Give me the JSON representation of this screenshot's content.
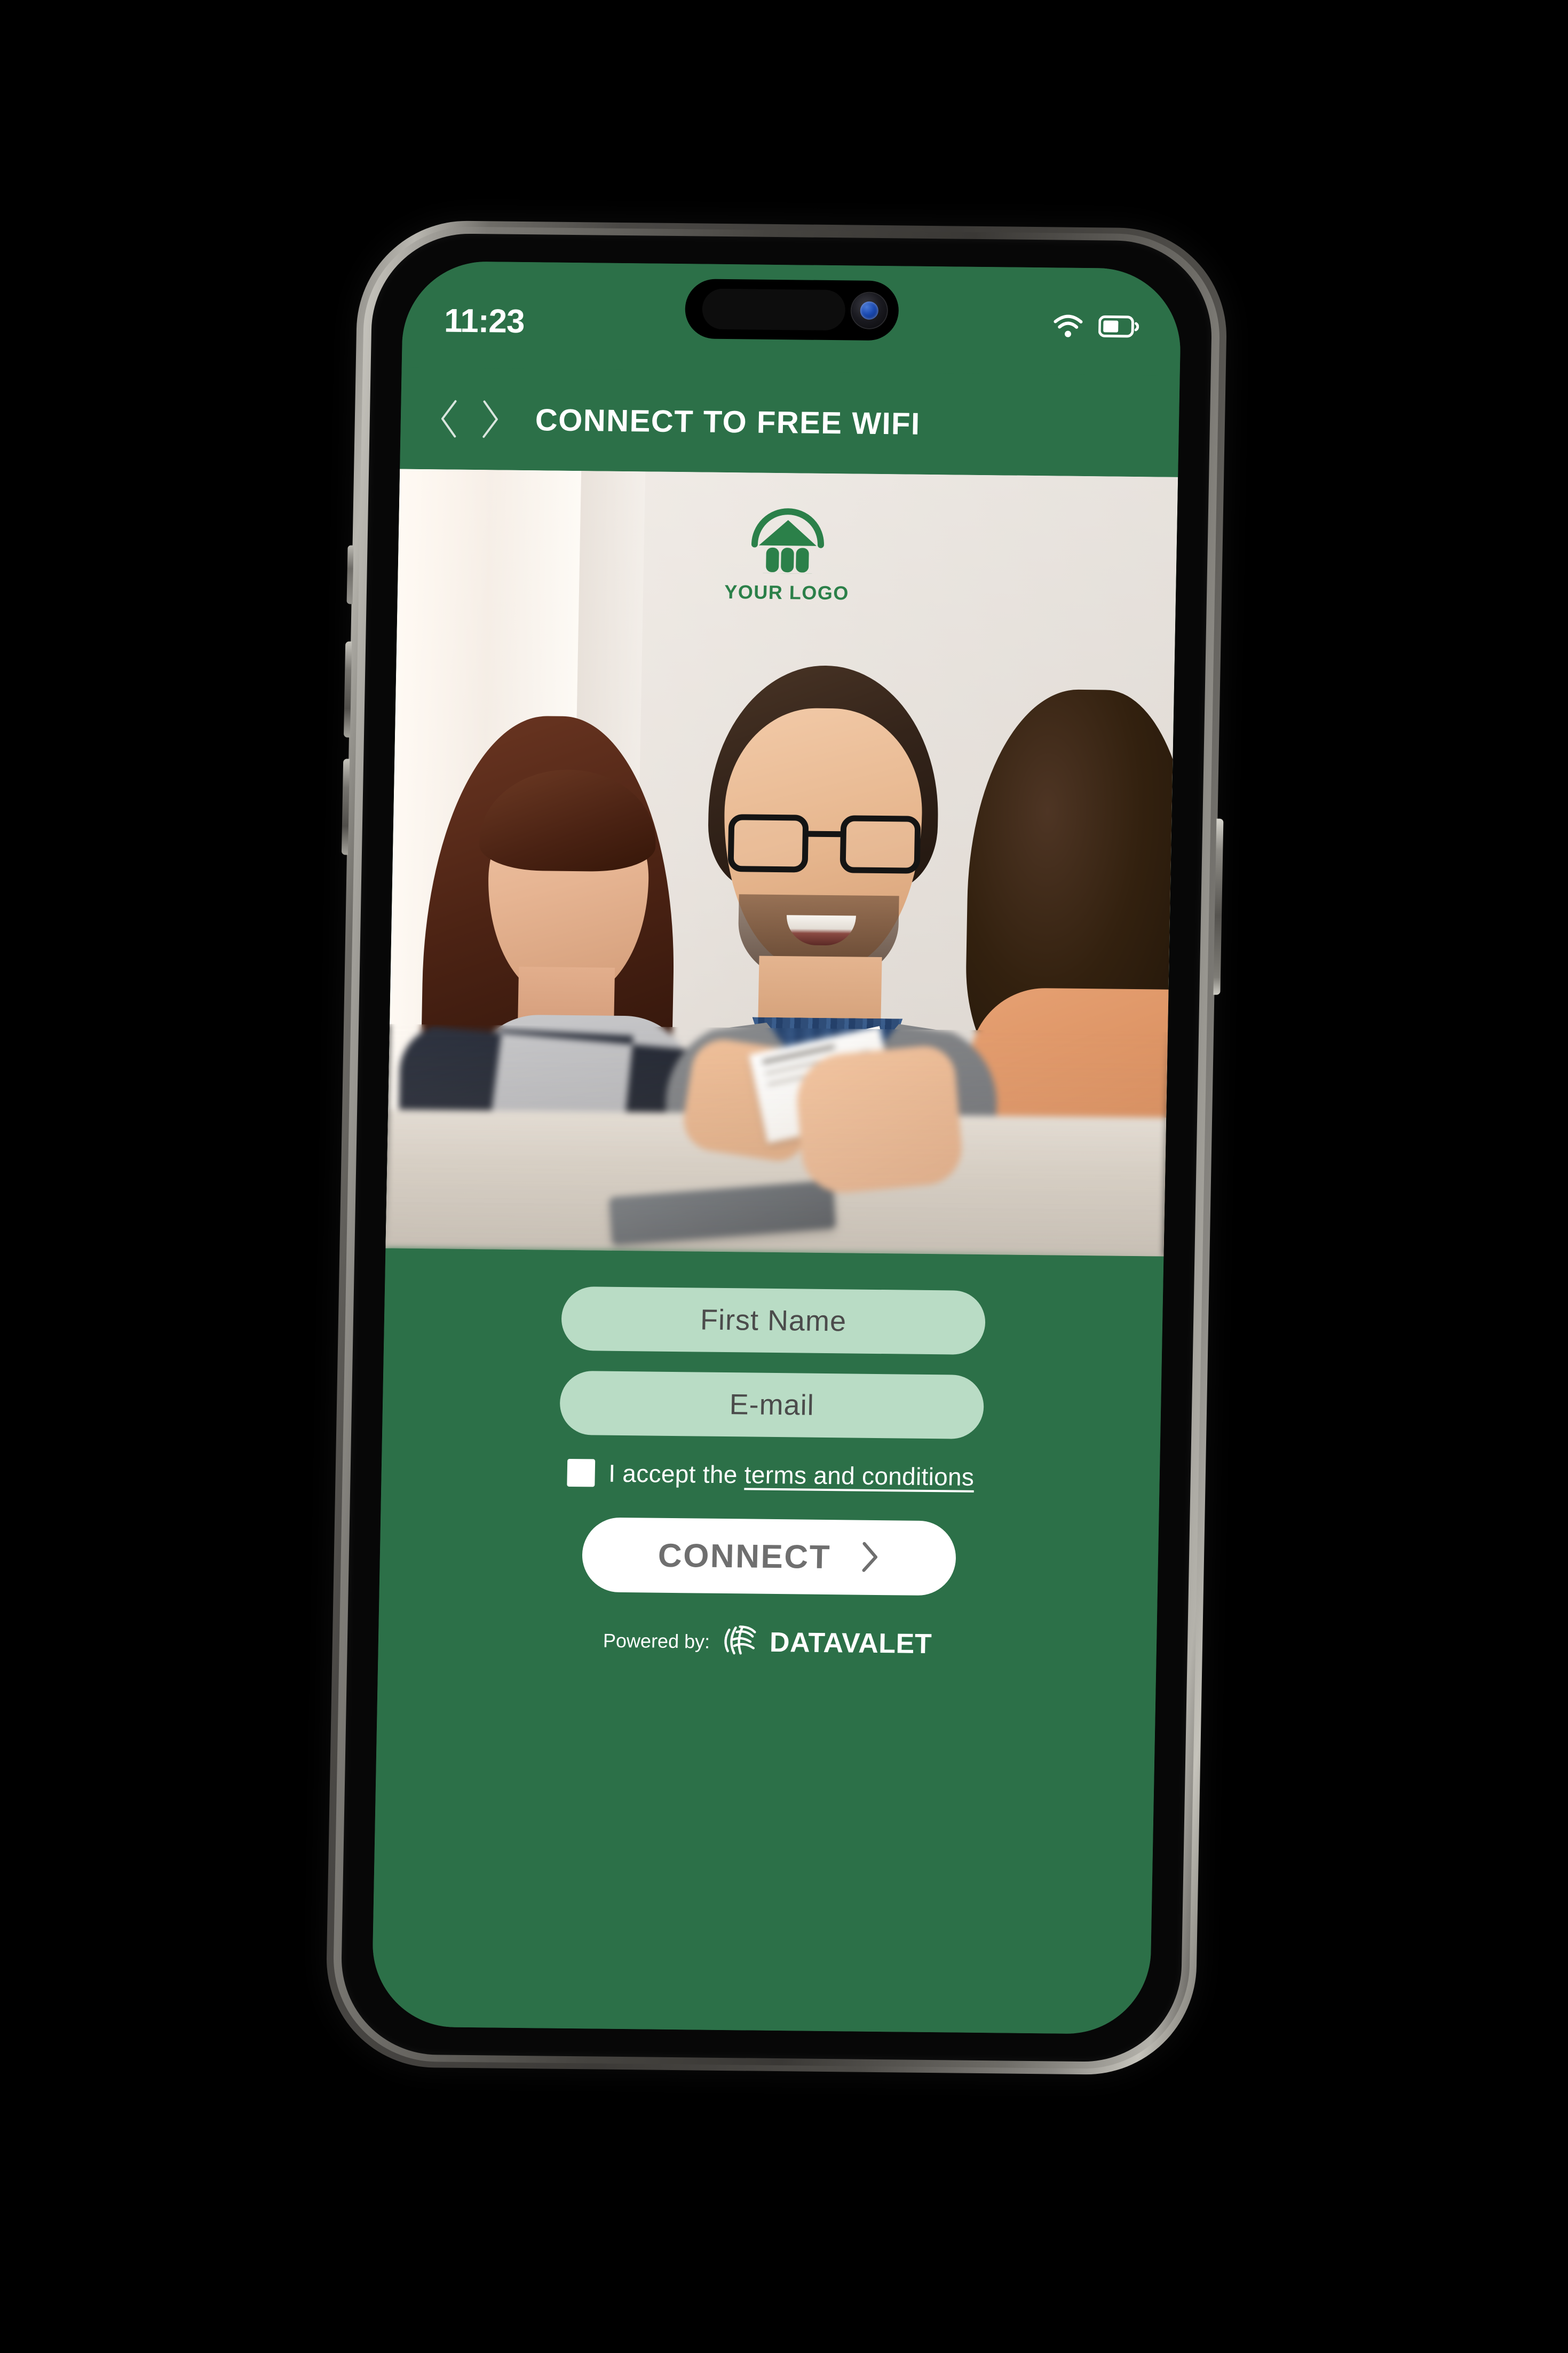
{
  "device": {
    "type": "smartphone-mockup",
    "frame_color": "#5a5854"
  },
  "status_bar": {
    "time": "11:23",
    "wifi_icon": "wifi-icon",
    "battery_icon": "battery-icon",
    "background": "#2c7048"
  },
  "app_bar": {
    "title": "CONNECT TO FREE WIFI",
    "back_icon": "chevron-left-icon",
    "forward_icon": "chevron-right-icon"
  },
  "hero": {
    "logo": {
      "icon": "bank-columns-icon",
      "label": "YOUR LOGO",
      "color": "#2b8049"
    },
    "alt": "Two smiling clients at a bank desk with an advisor holding a document"
  },
  "form": {
    "first_name": {
      "placeholder": "First Name",
      "value": ""
    },
    "email": {
      "placeholder": "E-mail",
      "value": ""
    },
    "terms": {
      "checkbox_checked": false,
      "prefix": "I accept the ",
      "link_label": "terms and conditions"
    },
    "submit": {
      "label": "CONNECT",
      "arrow_icon": "chevron-right-icon"
    },
    "field_background": "#b9dcc5",
    "panel_background": "#2c7048"
  },
  "footer": {
    "powered_by_label": "Powered by:",
    "brand_icon": "datavalet-fingerprint-icon",
    "brand_name": "DATAVALET"
  }
}
